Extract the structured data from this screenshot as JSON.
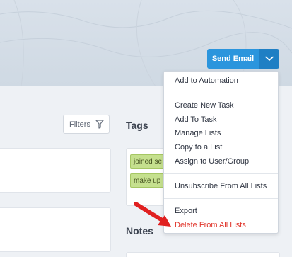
{
  "header": {
    "send_email_label": "Send Email"
  },
  "toolbar": {
    "filters_label": "Filters"
  },
  "tags_section": {
    "title": "Tags",
    "tags": [
      "joined se",
      "make up"
    ]
  },
  "notes_section": {
    "title": "Notes"
  },
  "dropdown": {
    "items": [
      {
        "label": "Add to Automation"
      },
      {
        "label": "Create New Task"
      },
      {
        "label": "Add To Task"
      },
      {
        "label": "Manage Lists"
      },
      {
        "label": "Copy to a List"
      },
      {
        "label": "Assign to User/Group"
      },
      {
        "label": "Unsubscribe From All Lists"
      },
      {
        "label": "Export"
      },
      {
        "label": "Delete From All Lists",
        "style": "danger"
      }
    ]
  },
  "colors": {
    "accent": "#2b95dd",
    "danger": "#e0342a",
    "tag_green": "#c5e08e",
    "annotation_arrow": "#e02020"
  },
  "icons": {
    "filter": "funnel-icon",
    "caret": "chevron-down-icon",
    "annotation": "red-arrow-icon"
  }
}
